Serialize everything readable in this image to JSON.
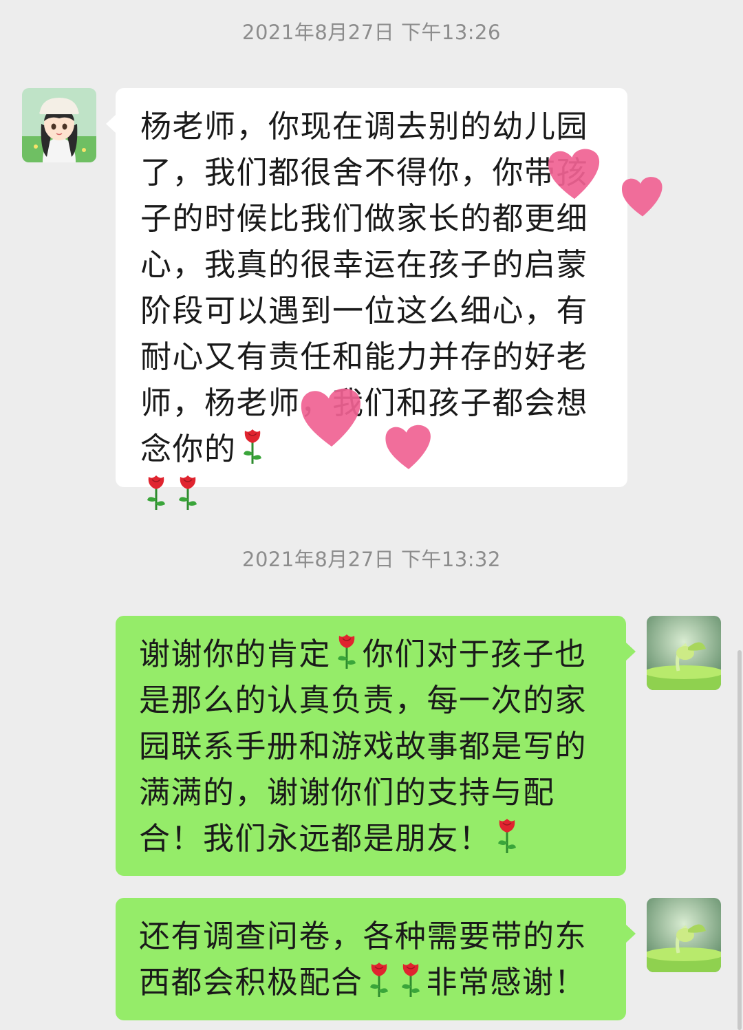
{
  "chat": {
    "messages": [
      {
        "timestamp": "2021年8月27日 下午13:26",
        "sender": "other",
        "avatar_icon": "anime-girl-avatar",
        "text_parts": [
          "杨老师，你现在调去别的幼儿园了，我们都很舍不得你，你带孩子的时候比我们做家长的都更细心，我真的很幸运在孩子的启蒙阶段可以遇到一位这么细心，有耐心又有责任和能力并存的好老师，杨老师，我们和孩子都会想念你的",
          ""
        ],
        "rose_count": 3
      },
      {
        "timestamp": "2021年8月27日 下午13:32",
        "sender": "me",
        "avatar_icon": "sprout-avatar",
        "text_parts": [
          "谢谢你的肯定",
          "你们对于孩子也是那么的认真负责，每一次的家园联系手册和游戏故事都是写的满满的，谢谢你们的支持与配合！我们永远都是朋友！"
        ]
      },
      {
        "sender": "me",
        "avatar_icon": "sprout-avatar",
        "text_parts": [
          "还有调查问卷，各种需要带的东西都会积极配合",
          "非常感谢！"
        ]
      }
    ],
    "emoji": "rose-emoji",
    "sticker": "pink-heart-sticker"
  },
  "colors": {
    "background": "#ededed",
    "incoming_bubble": "#ffffff",
    "outgoing_bubble": "#95ec69",
    "timestamp_text": "#8c8c8c",
    "heart_pink": "#f06292"
  }
}
